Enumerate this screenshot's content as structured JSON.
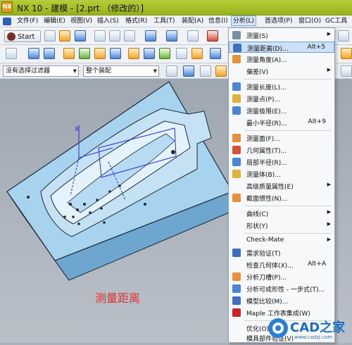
{
  "window": {
    "title": "NX 10 - 建模 - [2.prt （修改的）]"
  },
  "menubar": [
    "文件(F)",
    "编辑(E)",
    "视图(V)",
    "插入(S)",
    "格式(R)",
    "工具(T)",
    "装配(A)",
    "信息(I)",
    "分析(L)",
    "首选项(P)",
    "窗口(O)",
    "GC工具箱"
  ],
  "toolbar": {
    "start_label": "Start",
    "filter_value": "没有选择过滤器",
    "assembly_value": "整个装配"
  },
  "analysis_menu": [
    {
      "label": "测量(S)",
      "submenu": true
    },
    {
      "label": "测量距离(D)...",
      "shortcut": "Alt+5",
      "highlighted": true
    },
    {
      "label": "测量角度(A)..."
    },
    {
      "label": "偏差(V)",
      "submenu": true
    },
    {
      "label": "测量长度(L)..."
    },
    {
      "label": "测量点(P)..."
    },
    {
      "label": "测量极限(E)..."
    },
    {
      "label": "最小半径(R)...",
      "shortcut": "Alt+9"
    },
    {
      "label": "测量面(F)..."
    },
    {
      "label": "几何属性(T)..."
    },
    {
      "label": "局部半径(R)..."
    },
    {
      "label": "测量体(B)..."
    },
    {
      "label": "高级质量属性(E)",
      "submenu": true
    },
    {
      "label": "截面惯性(N)..."
    },
    {
      "label": "曲线(C)",
      "submenu": true
    },
    {
      "label": "形状(Y)",
      "submenu": true
    },
    {
      "label": "Check-Mate",
      "submenu": true
    },
    {
      "label": "需求验证(T)"
    },
    {
      "label": "检查几何体(X)...",
      "shortcut": "Alt+A"
    },
    {
      "label": "分析刀槽(P)..."
    },
    {
      "label": "分析可成形性 - 一步式(T)..."
    },
    {
      "label": "模型比较(M)..."
    },
    {
      "label": "Maple 工作表集成(W)"
    },
    {
      "label": "优化(O)"
    },
    {
      "label": "模具部件验证(V)"
    }
  ],
  "viewport": {
    "callout": "测量距离",
    "triad_x": "X"
  },
  "watermark": {
    "brand": "CAD之家",
    "url": "www.cadzj.com"
  },
  "colors": {
    "accent": "#e2312b",
    "titlebar": "#a9c22a",
    "part": "#a8d3ee"
  }
}
